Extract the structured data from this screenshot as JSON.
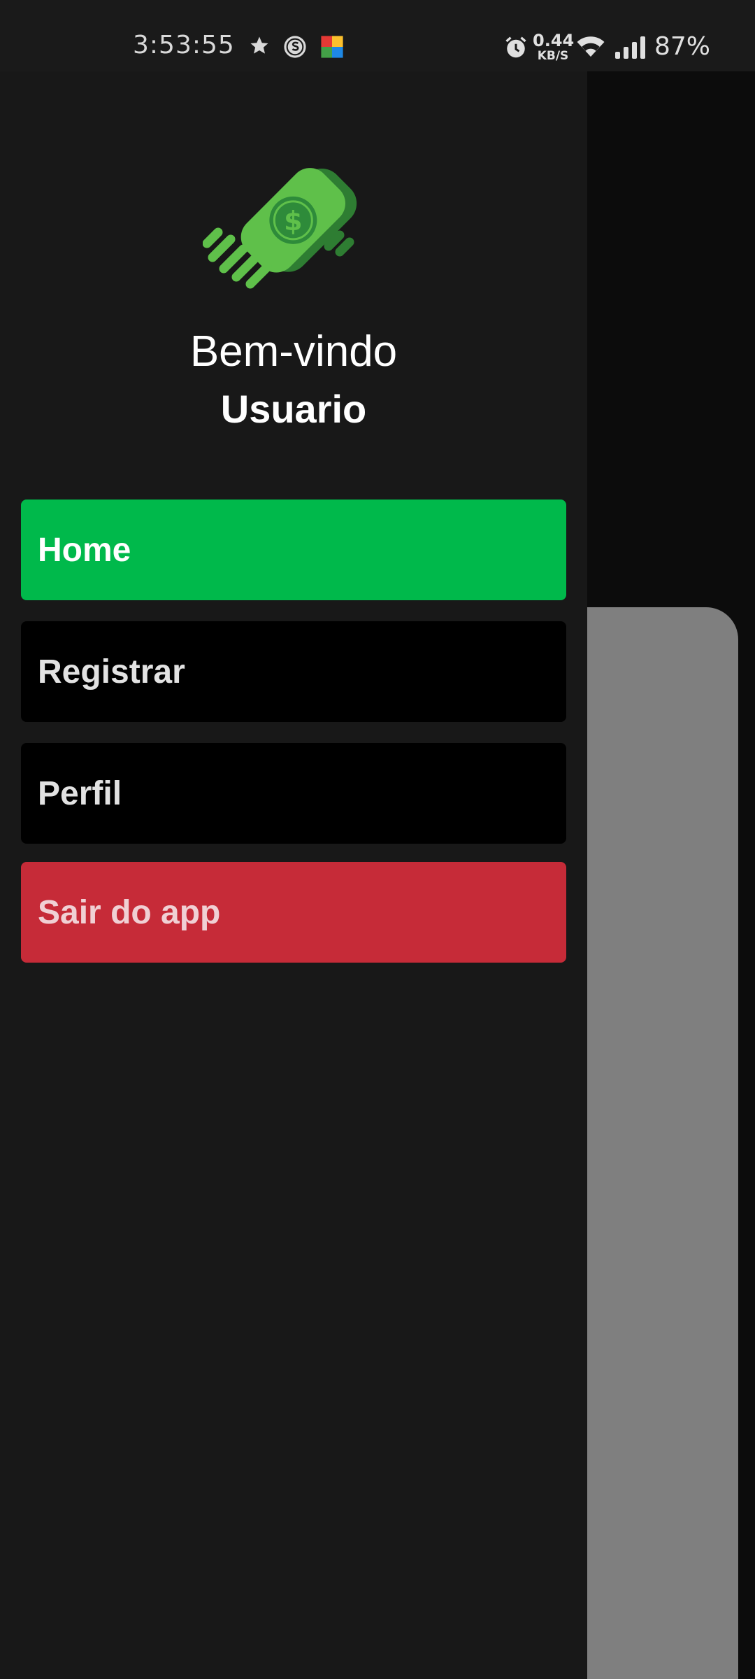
{
  "status_bar": {
    "time": "3:53:55",
    "net_speed_value": "0.44",
    "net_speed_unit": "KB/S",
    "battery": "87%",
    "icons": [
      "star-icon",
      "s-circle-icon",
      "currency-app-icon",
      "alarm-icon",
      "wifi-icon",
      "signal-icon"
    ]
  },
  "drawer": {
    "logo": "money-bill-logo",
    "welcome_line": "Bem-vindo",
    "user_name": "Usuario",
    "menu": [
      {
        "label": "Home",
        "color": "#00b94b"
      },
      {
        "label": "Registrar",
        "color": "#000000"
      },
      {
        "label": "Perfil",
        "color": "#000000"
      },
      {
        "label": "Sair do app",
        "color": "#c62b38"
      }
    ]
  },
  "colors": {
    "drawer_bg": "#181818",
    "accent_green": "#00b94b",
    "logout_red": "#c62b38",
    "background_card": "#7f7f7f"
  }
}
